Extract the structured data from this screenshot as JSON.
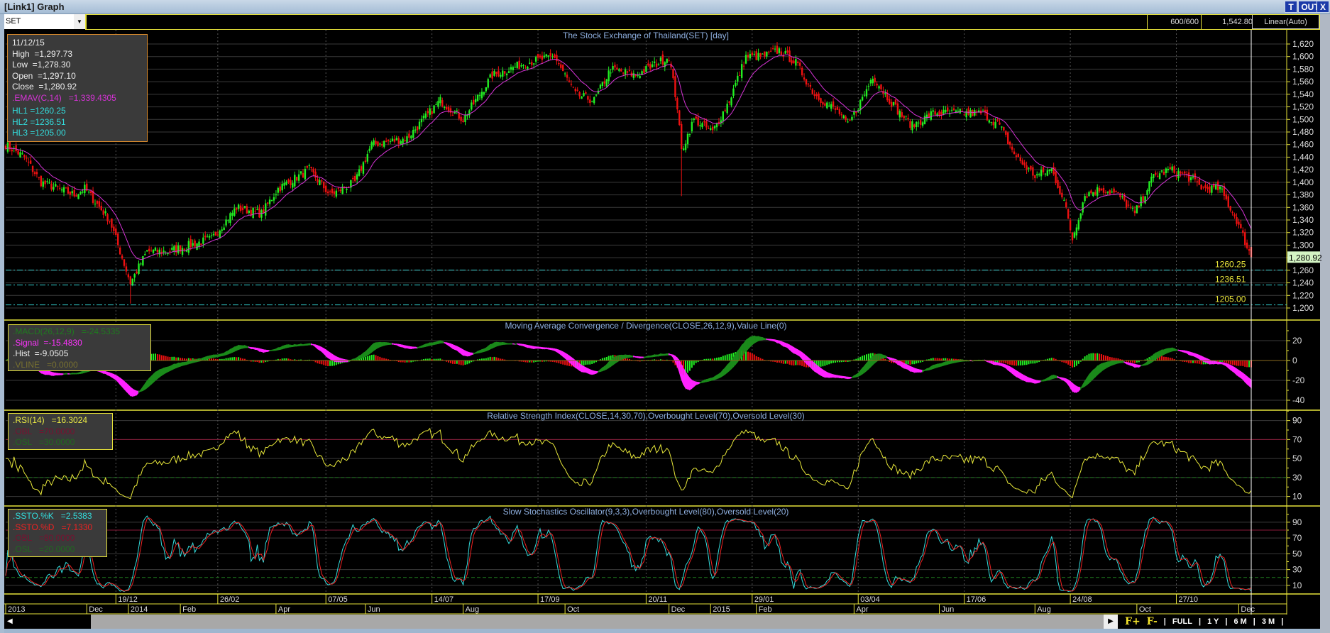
{
  "window": {
    "title": "[Link1] Graph",
    "buttons": [
      "T",
      "OUT",
      "X"
    ]
  },
  "toolbar": {
    "symbol": "SET",
    "bars": "600/600",
    "cursor_price": "1,542.80",
    "scale": "Linear(Auto)"
  },
  "price_info": {
    "date": "11/12/15",
    "high": "High  =1,297.73",
    "low": "Low  =1,278.30",
    "open": "Open  =1,297.10",
    "close": "Close  =1,280.92",
    "emav": ".EMAV(C,14)   =1,339.4305",
    "hl1": "HL1 =1260.25",
    "hl2": "HL2 =1236.51",
    "hl3": "HL3 =1205.00"
  },
  "macd_info": {
    "macd": ".MACD(26,12,9)   =-24.5335",
    "signal": ".Signal  =-15.4830",
    "hist": ".Hist  =-9.0505",
    "vline": ".VLINE   =0.0000"
  },
  "rsi_info": {
    "rsi": ".RSI(14)   =16.3024",
    "obl": ".OBL   =70.0000",
    "osl": ".OSL   =30.0000"
  },
  "ssto_info": {
    "k": ".SSTO.%K   =2.5383",
    "d": ".SSTO.%D   =7.1330",
    "obl": ".OBL   =80.0000",
    "osl": ".OSL   =20.0000"
  },
  "colors": {
    "up": "#22ee22",
    "down": "#ee1111",
    "ema": "#d633d6",
    "hl": "#33cccc",
    "axis": "#e6e23a",
    "macd_up": "#1a8a1a",
    "macd_dn": "#ff22ff",
    "rsi": "#e8e83a",
    "ssto_k": "#33dddd",
    "ssto_d": "#ee2222"
  },
  "chart_data": [
    {
      "type": "candlestick",
      "title": "The Stock Exchange of Thailand(SET) [day]",
      "bars": 600,
      "close_keypoints": [
        [
          0,
          1460
        ],
        [
          9,
          1440
        ],
        [
          17,
          1400
        ],
        [
          33,
          1380
        ],
        [
          38,
          1390
        ],
        [
          50,
          1340
        ],
        [
          60,
          1240
        ],
        [
          68,
          1290
        ],
        [
          78,
          1290
        ],
        [
          99,
          1310
        ],
        [
          111,
          1360
        ],
        [
          123,
          1350
        ],
        [
          131,
          1390
        ],
        [
          146,
          1420
        ],
        [
          156,
          1380
        ],
        [
          168,
          1400
        ],
        [
          176,
          1460
        ],
        [
          193,
          1470
        ],
        [
          209,
          1530
        ],
        [
          220,
          1500
        ],
        [
          234,
          1570
        ],
        [
          250,
          1590
        ],
        [
          264,
          1600
        ],
        [
          274,
          1540
        ],
        [
          283,
          1530
        ],
        [
          291,
          1580
        ],
        [
          303,
          1570
        ],
        [
          319,
          1600
        ],
        [
          323,
          1520
        ],
        [
          325,
          1450
        ],
        [
          331,
          1500
        ],
        [
          340,
          1480
        ],
        [
          348,
          1530
        ],
        [
          356,
          1600
        ],
        [
          364,
          1600
        ],
        [
          372,
          1610
        ],
        [
          380,
          1590
        ],
        [
          389,
          1540
        ],
        [
          401,
          1510
        ],
        [
          405,
          1490
        ],
        [
          413,
          1540
        ],
        [
          417,
          1570
        ],
        [
          423,
          1540
        ],
        [
          430,
          1510
        ],
        [
          436,
          1490
        ],
        [
          446,
          1510
        ],
        [
          458,
          1510
        ],
        [
          470,
          1510
        ],
        [
          478,
          1490
        ],
        [
          486,
          1440
        ],
        [
          495,
          1410
        ],
        [
          503,
          1420
        ],
        [
          509,
          1370
        ],
        [
          513,
          1310
        ],
        [
          519,
          1380
        ],
        [
          527,
          1390
        ],
        [
          535,
          1380
        ],
        [
          543,
          1350
        ],
        [
          552,
          1410
        ],
        [
          560,
          1420
        ],
        [
          568,
          1410
        ],
        [
          576,
          1390
        ],
        [
          584,
          1390
        ],
        [
          592,
          1340
        ],
        [
          599,
          1280.92
        ]
      ],
      "last_bar": {
        "open": 1297.1,
        "high": 1297.73,
        "low": 1278.3,
        "close": 1280.92
      },
      "ylim": [
        1185,
        1630
      ],
      "yticks": [
        "1,620",
        "1,600",
        "1,580",
        "1,560",
        "1,540",
        "1,520",
        "1,500",
        "1,480",
        "1,460",
        "1,440",
        "1,420",
        "1,400",
        "1,380",
        "1,360",
        "1,340",
        "1,320",
        "1,300",
        "1,280",
        "1,260",
        "1,240",
        "1,220",
        "1,200"
      ],
      "ytick_values": [
        1620,
        1600,
        1580,
        1560,
        1540,
        1520,
        1500,
        1480,
        1460,
        1440,
        1420,
        1400,
        1380,
        1360,
        1340,
        1320,
        1300,
        1280,
        1260,
        1240,
        1220,
        1200
      ],
      "hlines": [
        {
          "value": 1260.25,
          "label": "1260.25"
        },
        {
          "value": 1236.51,
          "label": "1236.51"
        },
        {
          "value": 1205.0,
          "label": "1205.00"
        }
      ],
      "last_label": "1,280.92",
      "ema_period": 14
    },
    {
      "type": "macd",
      "title": "Moving Average Convergence / Divergence(CLOSE,26,12,9),Value Line(0)",
      "ylim": [
        -45,
        25
      ],
      "yticks": [
        "20",
        "0",
        "-20",
        "-40"
      ],
      "ytick_values": [
        20,
        0,
        -20,
        -40
      ]
    },
    {
      "type": "line",
      "title": "Relative Strength Index(CLOSE,14,30,70),Overbought Level(70),Oversold Level(30)",
      "ylim": [
        0,
        100
      ],
      "yticks": [
        "90",
        "70",
        "50",
        "30",
        "10"
      ],
      "ytick_values": [
        90,
        70,
        50,
        30,
        10
      ],
      "levels": [
        70,
        30
      ]
    },
    {
      "type": "line",
      "title": "Slow Stochastics Oscillator(9,3,3),Overbought Level(80),Oversold Level(20)",
      "ylim": [
        0,
        100
      ],
      "yticks": [
        "90",
        "70",
        "50",
        "30",
        "10"
      ],
      "ytick_values": [
        90,
        70,
        50,
        30,
        10
      ],
      "levels": [
        80,
        20
      ]
    }
  ],
  "x_axis": {
    "top": [
      {
        "bar": 53,
        "label": "19/12"
      },
      {
        "bar": 102,
        "label": "26/02"
      },
      {
        "bar": 154,
        "label": "07/05"
      },
      {
        "bar": 205,
        "label": "14/07"
      },
      {
        "bar": 256,
        "label": "17/09"
      },
      {
        "bar": 308,
        "label": "20/11"
      },
      {
        "bar": 359,
        "label": "29/01"
      },
      {
        "bar": 410,
        "label": "03/04"
      },
      {
        "bar": 461,
        "label": "17/06"
      },
      {
        "bar": 512,
        "label": "24/08"
      },
      {
        "bar": 563,
        "label": "27/10"
      }
    ],
    "bottom": [
      {
        "bar": 0,
        "label": "2013"
      },
      {
        "bar": 39,
        "label": "Dec"
      },
      {
        "bar": 59,
        "label": "2014"
      },
      {
        "bar": 84,
        "label": "Feb"
      },
      {
        "bar": 130,
        "label": "Apr"
      },
      {
        "bar": 173,
        "label": "Jun"
      },
      {
        "bar": 220,
        "label": "Aug"
      },
      {
        "bar": 269,
        "label": "Oct"
      },
      {
        "bar": 319,
        "label": "Dec"
      },
      {
        "bar": 339,
        "label": "2015"
      },
      {
        "bar": 361,
        "label": "Feb"
      },
      {
        "bar": 408,
        "label": "Apr"
      },
      {
        "bar": 449,
        "label": "Jun"
      },
      {
        "bar": 495,
        "label": "Aug"
      },
      {
        "bar": 544,
        "label": "Oct"
      },
      {
        "bar": 593,
        "label": "Dec"
      }
    ]
  },
  "period_tools": {
    "zoom_in": "F+",
    "zoom_out": "F-",
    "full": "FULL",
    "y1": "1 Y",
    "m6": "6 M",
    "m3": "3 M",
    "sep": "|"
  }
}
